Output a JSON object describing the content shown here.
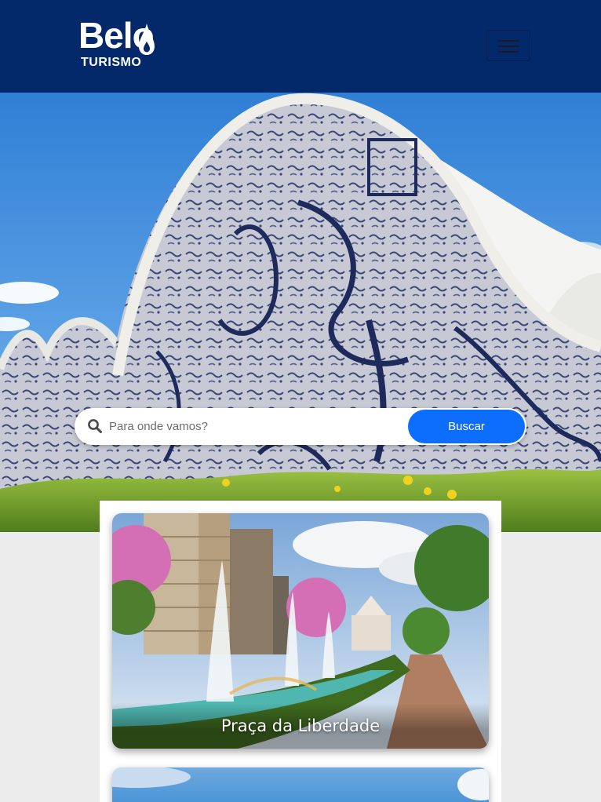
{
  "brand": {
    "name": "Belo",
    "tagline": "TURISMO"
  },
  "header": {
    "menu_icon": "hamburger-icon",
    "background": "#04296a"
  },
  "search": {
    "placeholder": "Para onde vamos?",
    "button_label": "Buscar",
    "icon": "search-icon",
    "button_color": "#0d6efd"
  },
  "cards": [
    {
      "title": "Praça da Liberdade"
    },
    {
      "title": ""
    }
  ]
}
